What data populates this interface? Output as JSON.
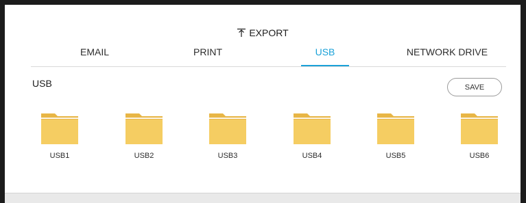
{
  "header": {
    "title": "EXPORT",
    "title_icon": "export-arrow-icon"
  },
  "tabs": [
    {
      "label": "EMAIL",
      "active": false
    },
    {
      "label": "PRINT",
      "active": false
    },
    {
      "label": "USB",
      "active": true
    },
    {
      "label": "NETWORK DRIVE",
      "active": false
    }
  ],
  "section": {
    "title": "USB",
    "save_label": "SAVE"
  },
  "folders": [
    {
      "label": "USB1",
      "icon": "folder-icon"
    },
    {
      "label": "USB2",
      "icon": "folder-icon"
    },
    {
      "label": "USB3",
      "icon": "folder-icon"
    },
    {
      "label": "USB4",
      "icon": "folder-icon"
    },
    {
      "label": "USB5",
      "icon": "folder-icon"
    },
    {
      "label": "USB6",
      "icon": "folder-icon"
    }
  ],
  "colors": {
    "accent": "#1aa1d8",
    "folder": "#f5cd62",
    "folder_tab": "#e8b646",
    "background": "#ffffff",
    "frame": "#1c1c1c"
  }
}
